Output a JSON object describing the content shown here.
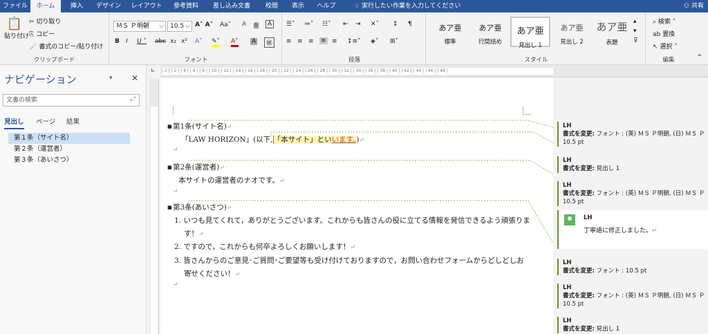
{
  "menu": {
    "tabs": [
      "ファイル",
      "ホーム",
      "挿入",
      "デザイン",
      "レイアウト",
      "参考資料",
      "差し込み文書",
      "校閲",
      "表示",
      "ヘルプ"
    ],
    "tellme": "実行したい作業を入力してください",
    "share": "共有"
  },
  "ribbon": {
    "clipboard": {
      "paste": "貼り付け",
      "cut": "切り取り",
      "copy": "コピー",
      "format_painter": "書式のコピー/貼り付け",
      "label": "クリップボード"
    },
    "font": {
      "font_name": "ＭＳ Ｐ明朝",
      "font_size": "10.5",
      "aa": "Aa",
      "label": "フォント"
    },
    "paragraph": {
      "label": "段落"
    },
    "styles": {
      "label": "スタイル",
      "items": [
        {
          "sample": "あア亜",
          "name": "標準"
        },
        {
          "sample": "あア亜",
          "name": "行間詰め"
        },
        {
          "sample": "あア亜",
          "name": "見出し 1"
        },
        {
          "sample": "あア亜",
          "name": "見出し 2"
        },
        {
          "sample": "あア亜",
          "name": "表題"
        }
      ]
    },
    "editing": {
      "find": "検索",
      "replace": "置換",
      "select": "選択",
      "label": "編集"
    }
  },
  "nav": {
    "title": "ナビゲーション",
    "search_placeholder": "文書の検索",
    "tabs": [
      "見出し",
      "ページ",
      "結果"
    ],
    "items": [
      "第１条（サイト名）",
      "第２条（運営者）",
      "第３条（あいさつ）"
    ]
  },
  "ruler_text": "| 2 |  | 2 |  | 4 |  | 6 |  | 8 |  | 10 |  | 12 |  | 14 |  | 16 |  | 18 |  | 20 |  | 22 |  | 24 |  | 26 |  | 28 |  | 30 |  | 32 |  | 34 |  | 36 |  | 38 |  | 40 |  | 42 |  | 44 |  | 46 |  | 48 |",
  "document": {
    "h1": "第1条(サイト名)",
    "p1_a": "「LAW HORIZON」(以下,",
    "p1_b": "「本サイト」とい",
    "p1_c": "います。",
    "p1_d": ")",
    "h2": "第2条(運営者)",
    "p2": "本サイトの運営者のナオです。",
    "h3": "第3条(あいさつ)",
    "li1_a": "1. いつも見てくれて，ありがとうございます。これからも皆さんの役に立てる情報を発信できるよう頑張りま",
    "li1_b": "す！",
    "li2": "2. ですので，これからも何卒よろしくお願いします！",
    "li3_a": "3. 皆さんからのご意見･ご質問･ご要望等も受け付けておりますので，お問い合わせフォームからどしどしお",
    "li3_b": "寄せください！",
    "pilcrow": "↵"
  },
  "comments": {
    "author": "LH",
    "change_label": "書式を変更:",
    "c1": "フォント : (英) ＭＳ Ｐ明朝, (日) ＭＳ Ｐ",
    "c1b": "10.5 pt",
    "c2": "見出し 1",
    "c3": "フォント : (英) ＭＳ Ｐ明朝, (日) ＭＳ Ｐ",
    "c3b": "10.5 pt",
    "c4": "丁寧語に修正しました。",
    "c5": "フォント : 10.5 pt",
    "c6": "フォント : (英) ＭＳ Ｐ明朝, (日) ＭＳ Ｐ",
    "c6b": "10.5 pt",
    "c7": "見出し 1"
  },
  "colors": {
    "accent": "#2b579a",
    "comment_bar": "#6b8e23",
    "insert": "#c0504d"
  }
}
